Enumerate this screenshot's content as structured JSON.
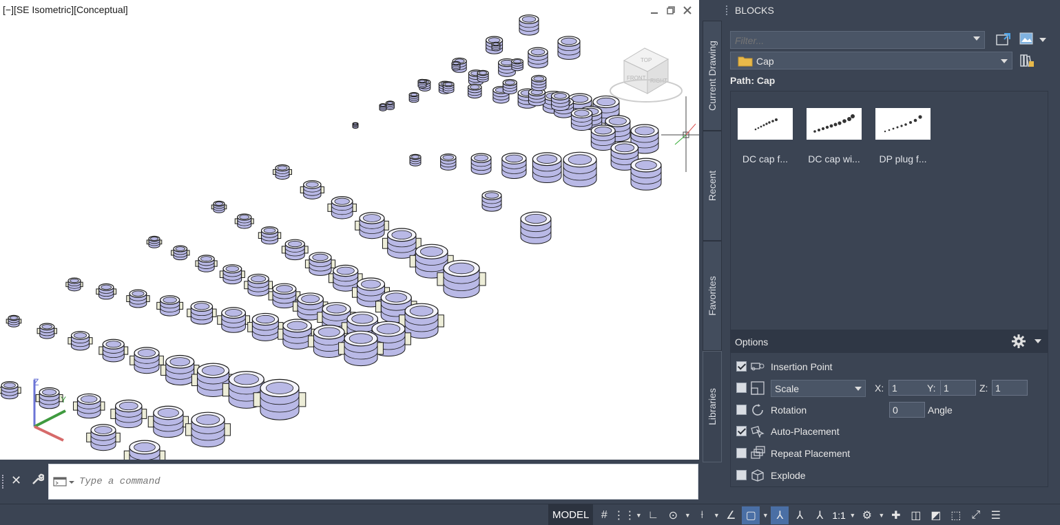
{
  "viewport": {
    "label": "[−][SE Isometric][Conceptual]"
  },
  "viewcube": {
    "top": "TOP",
    "front": "FRONT",
    "right": "RIGHT"
  },
  "command": {
    "placeholder": "Type a command"
  },
  "status": {
    "model": "MODEL",
    "scale": "1:1"
  },
  "tabs": {
    "current_drawing": "Current Drawing",
    "recent": "Recent",
    "favorites": "Favorites",
    "libraries": "Libraries"
  },
  "blocks": {
    "title": "BLOCKS",
    "filter_placeholder": "Filter...",
    "folder": "Cap",
    "path": "Path: Cap",
    "items": [
      {
        "label": "DC cap f..."
      },
      {
        "label": "DC cap wi..."
      },
      {
        "label": "DP plug f..."
      }
    ]
  },
  "options": {
    "title": "Options",
    "insertion_point": {
      "label": "Insertion Point",
      "checked": true
    },
    "scale": {
      "label": "Scale",
      "checked": false,
      "x_label": "X:",
      "x": "1",
      "y_label": "Y:",
      "y": "1",
      "z_label": "Z:",
      "z": "1"
    },
    "rotation": {
      "label": "Rotation",
      "checked": false,
      "angle_value": "0",
      "angle_label": "Angle"
    },
    "auto_placement": {
      "label": "Auto-Placement",
      "checked": true
    },
    "repeat_placement": {
      "label": "Repeat Placement",
      "checked": false
    },
    "explode": {
      "label": "Explode",
      "checked": false
    }
  },
  "colors": {
    "panel_bg": "#3b4453",
    "header_bg": "#2f3745",
    "part_fill": "#b9b9e6",
    "part_stroke": "#1a1a1a"
  }
}
